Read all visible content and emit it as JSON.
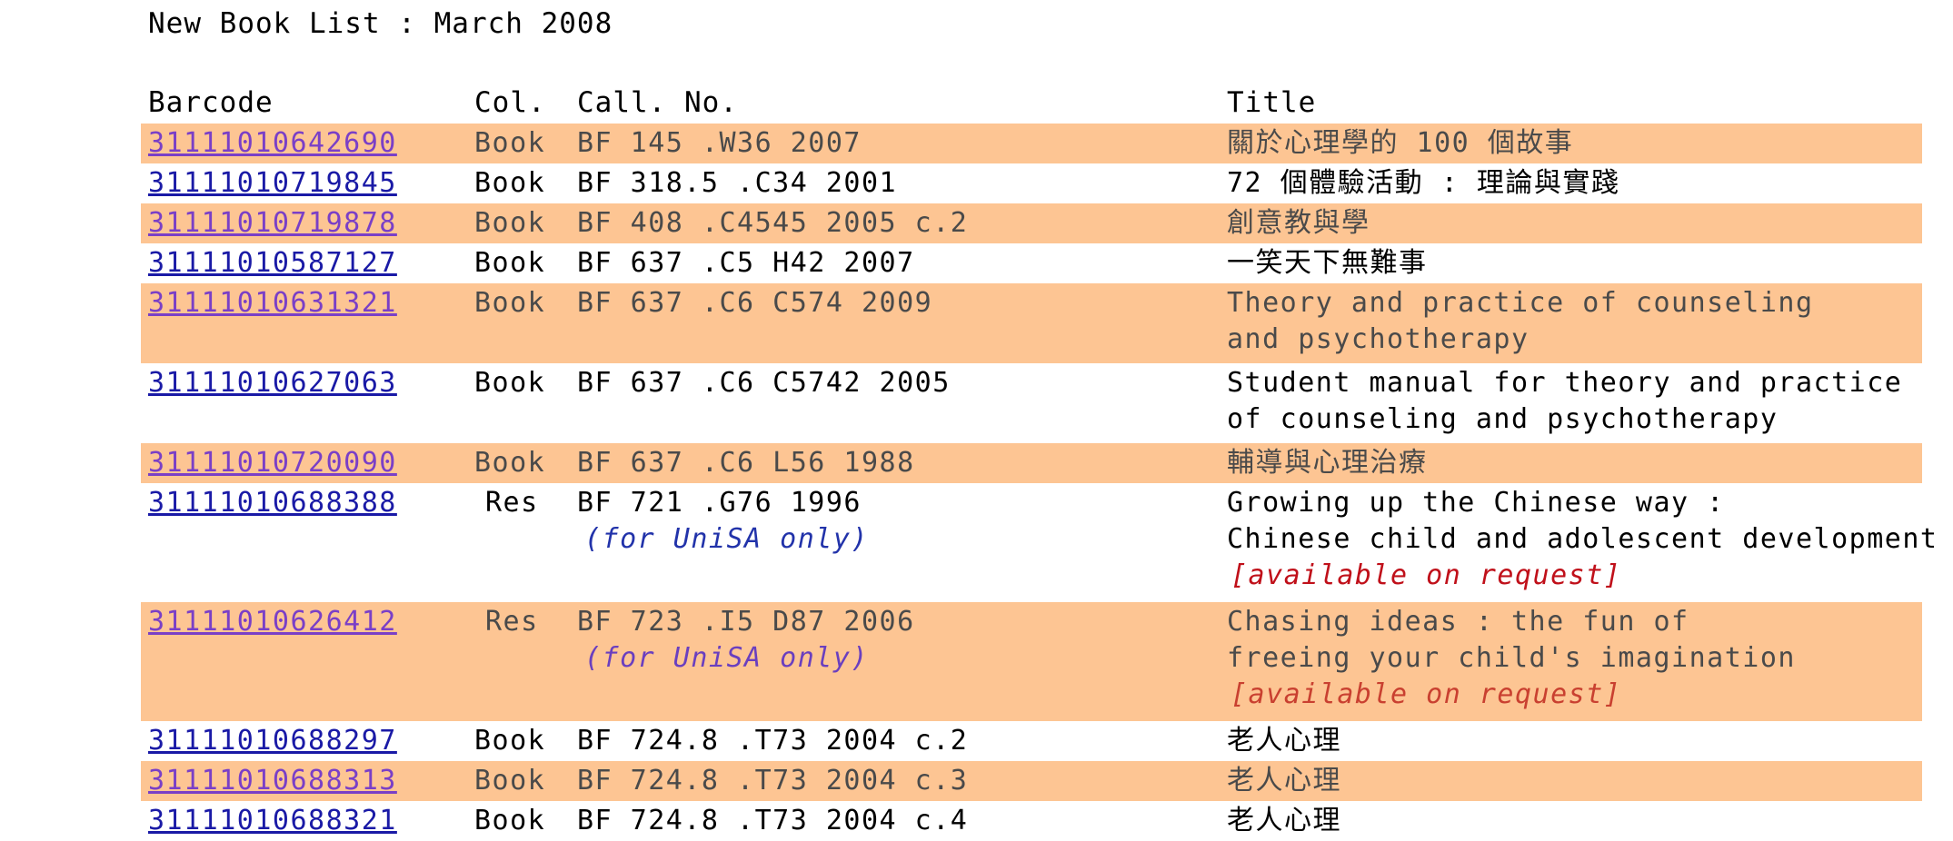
{
  "page_title": "New Book List : March 2008",
  "headers": {
    "barcode": "Barcode",
    "col": "Col.",
    "call": "Call. No.",
    "title": "Title"
  },
  "rows": [
    {
      "barcode": "31111010642690",
      "col": "Book",
      "call": "BF 145 .W36 2007",
      "title": [
        "關於心理學的 100 個故事"
      ],
      "call_note": "",
      "title_note": ""
    },
    {
      "barcode": "31111010719845",
      "col": "Book",
      "call": "BF 318.5 .C34 2001",
      "title": [
        "72 個體驗活動 : 理論與實踐"
      ],
      "call_note": "",
      "title_note": ""
    },
    {
      "barcode": "31111010719878",
      "col": "Book",
      "call": "BF 408 .C4545 2005 c.2",
      "title": [
        "創意教與學"
      ],
      "call_note": "",
      "title_note": ""
    },
    {
      "barcode": "31111010587127",
      "col": "Book",
      "call": "BF 637 .C5 H42 2007",
      "title": [
        "一笑天下無難事"
      ],
      "call_note": "",
      "title_note": ""
    },
    {
      "barcode": "31111010631321",
      "col": "Book",
      "call": "BF 637 .C6 C574 2009",
      "title": [
        "Theory and practice of counseling",
        "and psychotherapy"
      ],
      "call_note": "",
      "title_note": ""
    },
    {
      "barcode": "31111010627063",
      "col": "Book",
      "call": "BF 637 .C6 C5742 2005",
      "title": [
        "Student manual for theory and practice",
        "of counseling and psychotherapy"
      ],
      "call_note": "",
      "title_note": ""
    },
    {
      "barcode": "31111010720090",
      "col": "Book",
      "call": "BF 637 .C6 L56 1988",
      "title": [
        "輔導與心理治療"
      ],
      "call_note": "",
      "title_note": ""
    },
    {
      "barcode": "31111010688388",
      "col": "Res",
      "call": "BF 721 .G76 1996",
      "title": [
        "Growing up the Chinese way :",
        "Chinese child and adolescent development"
      ],
      "call_note": "(for UniSA only)",
      "title_note": "[available on request]"
    },
    {
      "barcode": "31111010626412",
      "col": "Res",
      "call": "BF 723 .I5 D87 2006",
      "title": [
        "Chasing ideas : the fun of",
        "freeing your child's imagination"
      ],
      "call_note": "(for UniSA only)",
      "title_note": "[available on request]"
    },
    {
      "barcode": "31111010688297",
      "col": "Book",
      "call": "BF 724.8 .T73 2004 c.2",
      "title": [
        "老人心理"
      ],
      "call_note": "",
      "title_note": ""
    },
    {
      "barcode": "31111010688313",
      "col": "Book",
      "call": "BF 724.8 .T73 2004 c.3",
      "title": [
        "老人心理"
      ],
      "call_note": "",
      "title_note": ""
    },
    {
      "barcode": "31111010688321",
      "col": "Book",
      "call": "BF 724.8 .T73 2004 c.4",
      "title": [
        "老人心理"
      ],
      "call_note": "",
      "title_note": ""
    }
  ]
}
